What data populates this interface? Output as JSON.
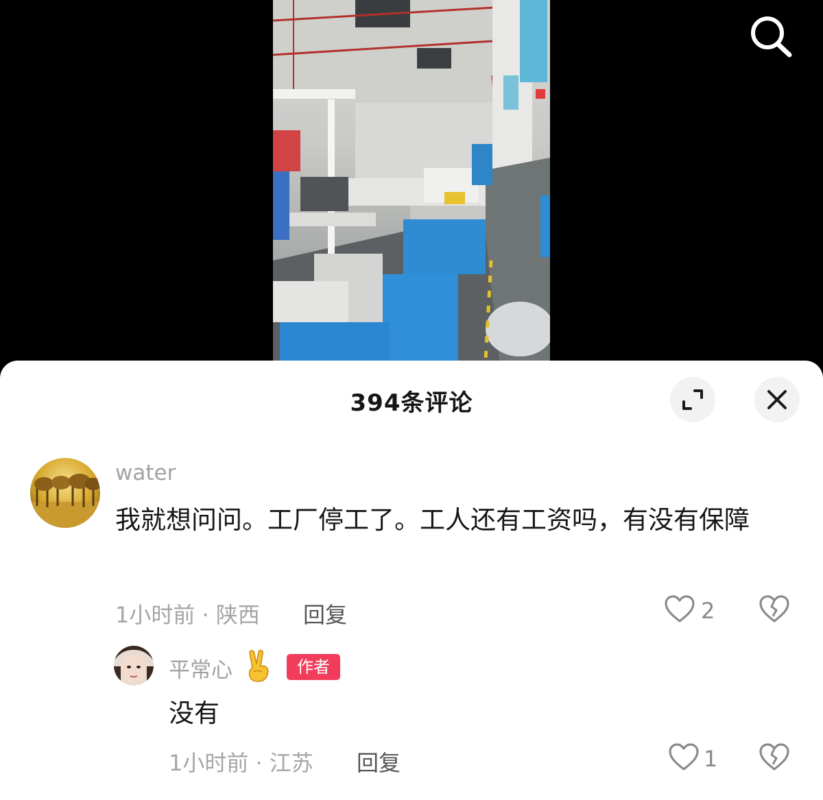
{
  "header": {
    "search_icon": "search-icon"
  },
  "sheet": {
    "title": "394条评论",
    "expand_icon": "expand-icon",
    "close_icon": "close-icon"
  },
  "comments": [
    {
      "username": "water",
      "text": "我就想问问。工厂停工了。工人还有工资吗，有没有保障",
      "meta": "1小时前 · 陕西",
      "reply_label": "回复",
      "likes": "2"
    }
  ],
  "replies": [
    {
      "username": "平常心",
      "emoji": "victory-hand-emoji",
      "badge": "作者",
      "text": "没有",
      "meta": "1小时前 · 江苏",
      "reply_label": "回复",
      "likes": "1"
    }
  ],
  "colors": {
    "badge": "#f23c5b",
    "secondary_text": "#a5a5a5",
    "primary_text": "#161616"
  }
}
